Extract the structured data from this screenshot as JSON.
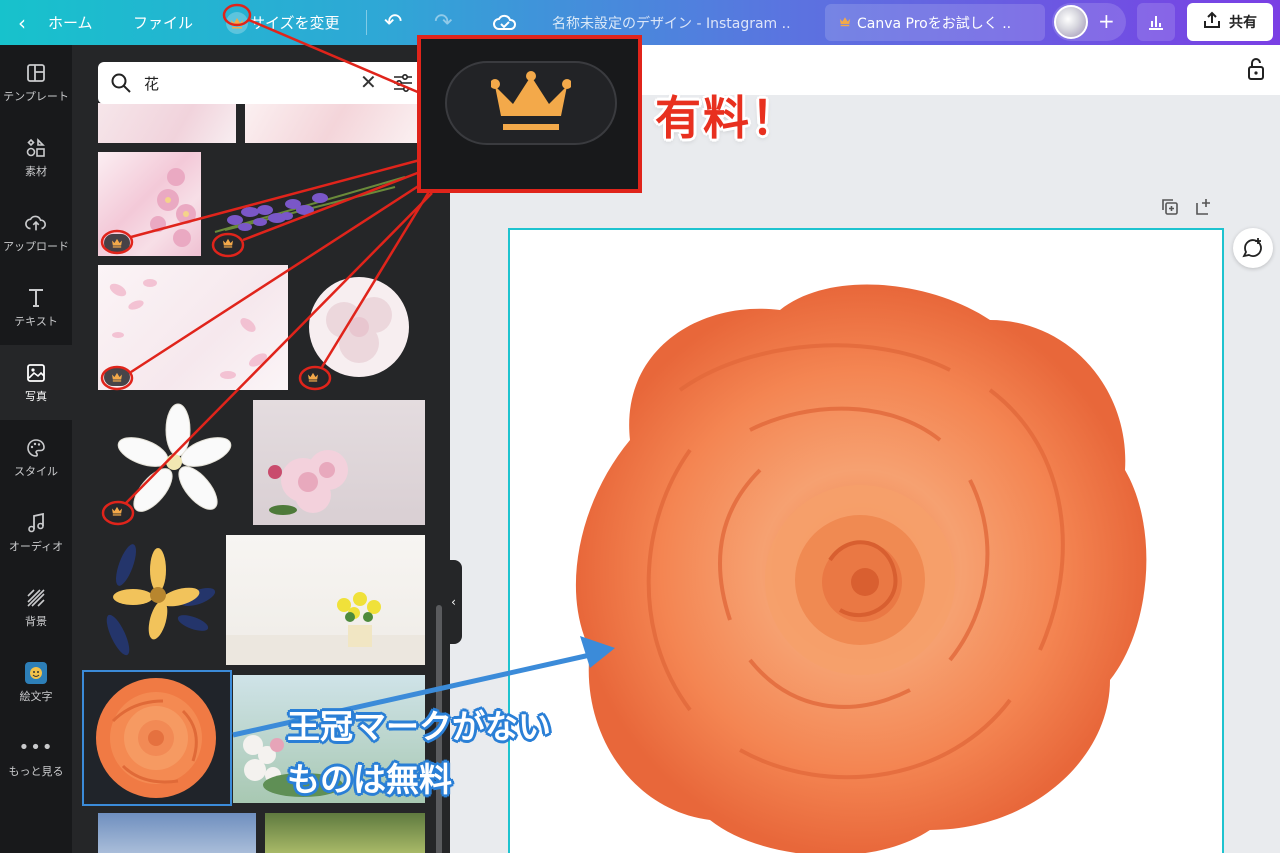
{
  "topbar": {
    "home_label": "ホーム",
    "file_label": "ファイル",
    "resize_label": "サイズを変更",
    "design_title": "名称未設定のデザイン - Instagram ..",
    "pro_label": "Canva Proをお試しく ..",
    "share_label": "共有"
  },
  "rail": {
    "items": [
      {
        "label": "テンプレート",
        "icon": "template-icon"
      },
      {
        "label": "素材",
        "icon": "elements-icon"
      },
      {
        "label": "アップロード",
        "icon": "upload-icon"
      },
      {
        "label": "テキスト",
        "icon": "text-icon"
      },
      {
        "label": "写真",
        "icon": "photo-icon"
      },
      {
        "label": "スタイル",
        "icon": "palette-icon"
      },
      {
        "label": "オーディオ",
        "icon": "music-icon"
      },
      {
        "label": "背景",
        "icon": "background-icon"
      },
      {
        "label": "絵文字",
        "icon": "emoji-icon"
      },
      {
        "label": "もっと見る",
        "icon": "more-icon"
      }
    ],
    "active": "写真"
  },
  "search": {
    "value": "花"
  },
  "annotations": {
    "paid": "有料！",
    "free_line1": "王冠マークがない",
    "free_line2": "ものは無料"
  },
  "colors": {
    "accent": "#1ec3cf",
    "crown": "#f3a94a",
    "annotation_red": "#e0241b",
    "annotation_blue": "#2a7fd6"
  }
}
